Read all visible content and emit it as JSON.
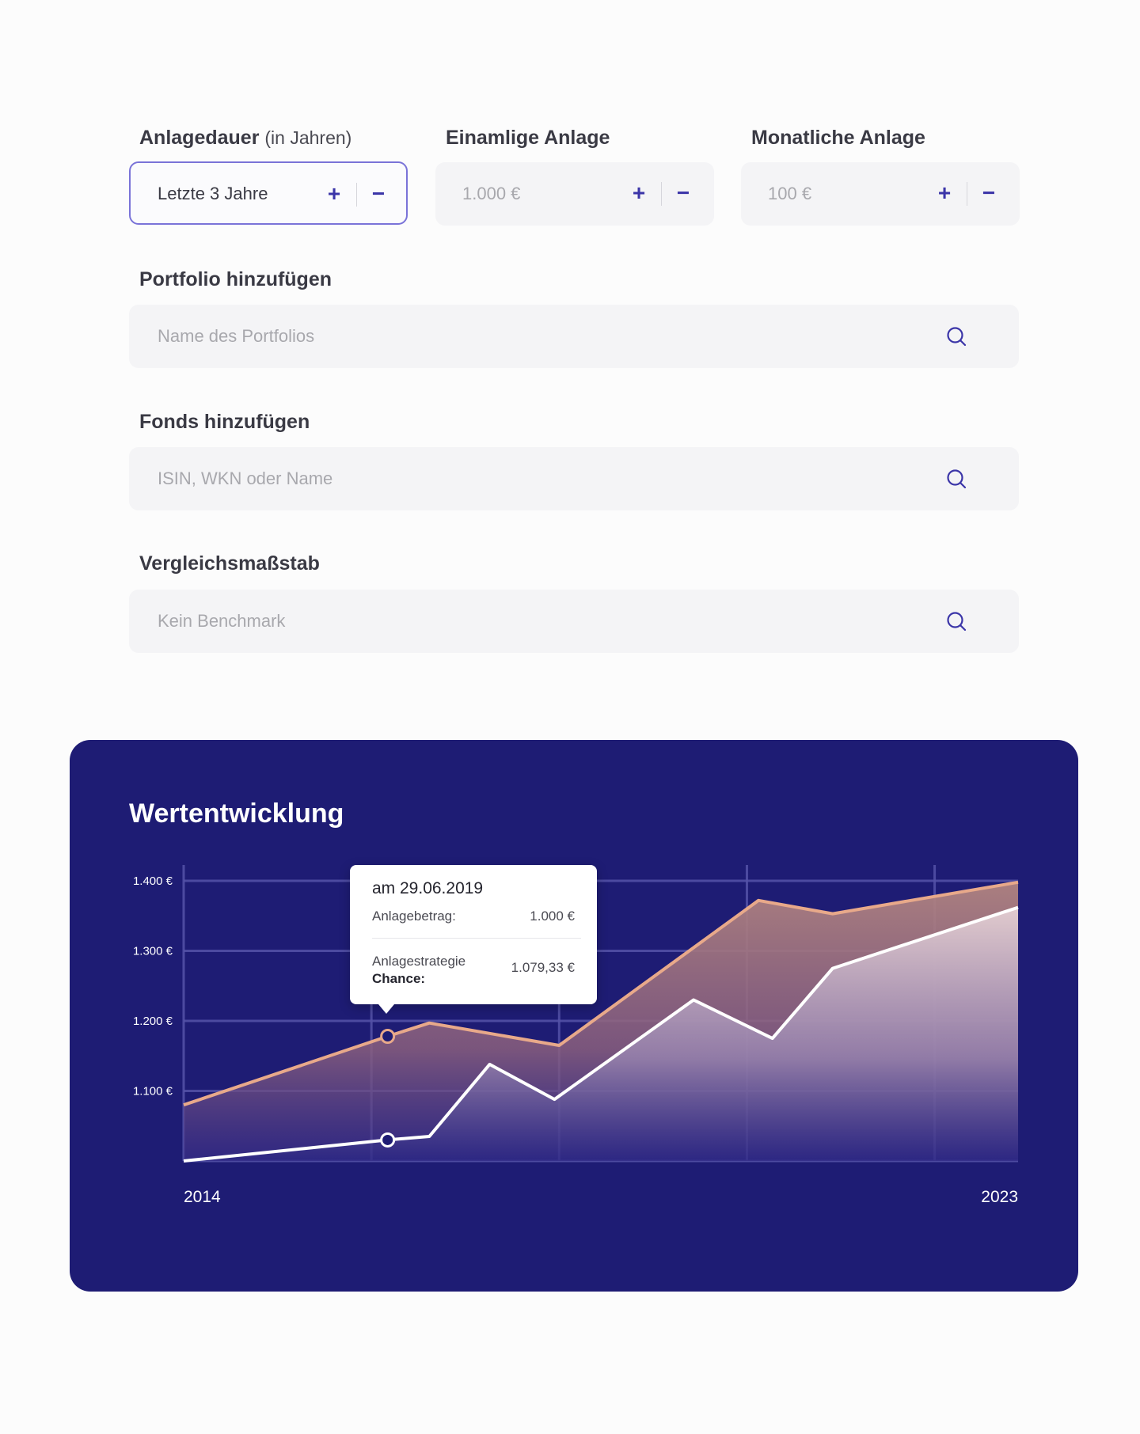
{
  "form": {
    "duration": {
      "label": "Anlagedauer",
      "label_suffix": "(in Jahren)",
      "value": "Letzte 3 Jahre",
      "plus": "+",
      "minus": "−"
    },
    "single": {
      "label": "Einamlige Anlage",
      "value": "1.000 €",
      "plus": "+",
      "minus": "−"
    },
    "monthly": {
      "label": "Monatliche Anlage",
      "value": "100 €",
      "plus": "+",
      "minus": "−"
    },
    "portfolio": {
      "label": "Portfolio hinzufügen",
      "placeholder": "Name des Portfolios"
    },
    "fonds": {
      "label": "Fonds hinzufügen",
      "placeholder": "ISIN, WKN oder Name"
    },
    "benchmark": {
      "label": "Vergleichsmaßstab",
      "placeholder": "Kein Benchmark"
    },
    "icons": {
      "search": "search-icon",
      "plus": "plus-icon",
      "minus": "minus-icon"
    }
  },
  "chart": {
    "title": "Wertentwicklung",
    "tooltip": {
      "date": "am 29.06.2019",
      "row1_label": "Anlagebetrag:",
      "row1_value": "1.000 €",
      "row2_label_line1": "Anlagestrategie",
      "row2_label_line2": "Chance:",
      "row2_value": "1.079,33 €"
    }
  },
  "chart_data": {
    "type": "area",
    "title": "Wertentwicklung",
    "xlabel": "",
    "ylabel": "",
    "x_tick_labels": [
      "2014",
      "2023"
    ],
    "y_tick_labels": [
      "1.400 €",
      "1.300 €",
      "1.200 €",
      "1.100 €"
    ],
    "y_ticks": [
      1400,
      1300,
      1200,
      1100
    ],
    "xlim": [
      2014,
      2023
    ],
    "ylim": [
      1000,
      1400
    ],
    "grid": true,
    "colors": {
      "background": "#1e1c74",
      "upper_line": "#e8a98a",
      "lower_line": "#ffffff",
      "grid": "#5553a8"
    },
    "series": [
      {
        "values": [
          [
            2014.0,
            1080
          ],
          [
            2016.2,
            1178
          ],
          [
            2016.65,
            1197
          ],
          [
            2018.05,
            1165
          ],
          [
            2020.2,
            1372
          ],
          [
            2021.0,
            1353
          ],
          [
            2023.0,
            1398
          ]
        ]
      },
      {
        "values": [
          [
            2014.0,
            1000
          ],
          [
            2016.2,
            1030
          ],
          [
            2016.65,
            1035
          ],
          [
            2017.3,
            1138
          ],
          [
            2018.0,
            1088
          ],
          [
            2019.5,
            1230
          ],
          [
            2020.35,
            1175
          ],
          [
            2021.0,
            1275
          ],
          [
            2023.0,
            1362
          ]
        ]
      }
    ],
    "highlight_x": 2016.2
  }
}
